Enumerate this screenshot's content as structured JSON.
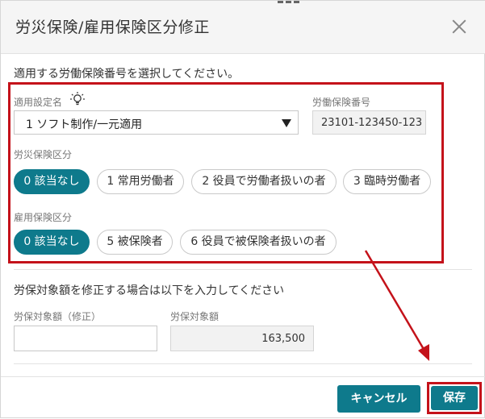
{
  "dialog": {
    "title": "労災保険/雇用保険区分修正",
    "close_icon": "close-icon"
  },
  "instruction": "適用する労働保険番号を選択してください。",
  "setting": {
    "label": "適用設定名",
    "hint_icon": "lightbulb-icon",
    "selected": "1 ソフト制作/一元適用"
  },
  "labor_insurance": {
    "label": "労働保険番号",
    "value": "23101-123450-123"
  },
  "workers_comp": {
    "label": "労災保険区分",
    "options": [
      "0 該当なし",
      "1 常用労働者",
      "2 役員で労働者扱いの者",
      "3 臨時労働者"
    ],
    "selected_index": 0
  },
  "employment": {
    "label": "雇用保険区分",
    "options": [
      "0 該当なし",
      "5 被保険者",
      "6 役員で被保険者扱いの者"
    ],
    "selected_index": 0
  },
  "edit_note": "労保対象額を修正する場合は以下を入力してください",
  "amount_edit": {
    "label": "労保対象額（修正）",
    "value": ""
  },
  "amount": {
    "label": "労保対象額",
    "value": "163,500"
  },
  "buttons": {
    "cancel": "キャンセル",
    "save": "保存"
  },
  "colors": {
    "accent": "#0e7a8c",
    "highlight": "#c4121a"
  }
}
